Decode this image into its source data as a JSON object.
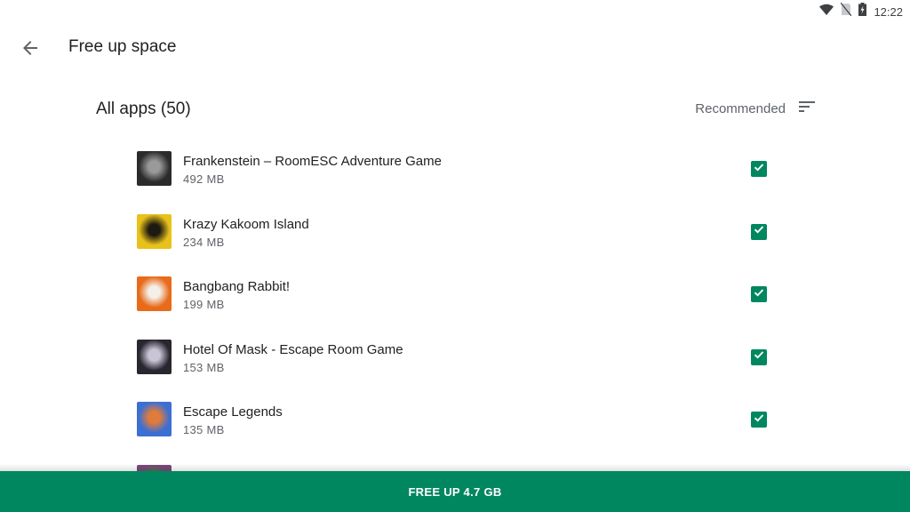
{
  "status_bar": {
    "time": "12:22",
    "icons": [
      "wifi-icon",
      "no-sim-icon",
      "battery-charging-icon"
    ]
  },
  "app_bar": {
    "back_icon": "arrow-back-icon",
    "title": "Free up space"
  },
  "section": {
    "title": "All apps (50)",
    "sort_label": "Recommended",
    "sort_icon": "sort-icon"
  },
  "apps": [
    {
      "name": "Frankenstein – RoomESC Adventure Game",
      "size": "492 MB",
      "checked": true,
      "icon_colors": [
        "#2b2b2b",
        "#9a9a9a"
      ]
    },
    {
      "name": "Krazy Kakoom Island",
      "size": "234 MB",
      "checked": true,
      "icon_colors": [
        "#e8c21a",
        "#1d1a10"
      ]
    },
    {
      "name": "Bangbang Rabbit!",
      "size": "199 MB",
      "checked": true,
      "icon_colors": [
        "#e86a1a",
        "#f4f0e8"
      ]
    },
    {
      "name": "Hotel Of Mask - Escape Room Game",
      "size": "153 MB",
      "checked": true,
      "icon_colors": [
        "#2a2630",
        "#c9c4d6"
      ]
    },
    {
      "name": "Escape Legends",
      "size": "135 MB",
      "checked": true,
      "icon_colors": [
        "#3b6fd4",
        "#e07b3c"
      ]
    },
    {
      "name": "",
      "size": "",
      "checked": false,
      "icon_colors": [
        "#7a4a7a",
        "#3b8a3b"
      ]
    }
  ],
  "colors": {
    "accent": "#01875f",
    "primary_text": "#202124",
    "secondary_text": "#5f6368"
  },
  "action": {
    "label": "FREE UP 4.7 GB"
  }
}
